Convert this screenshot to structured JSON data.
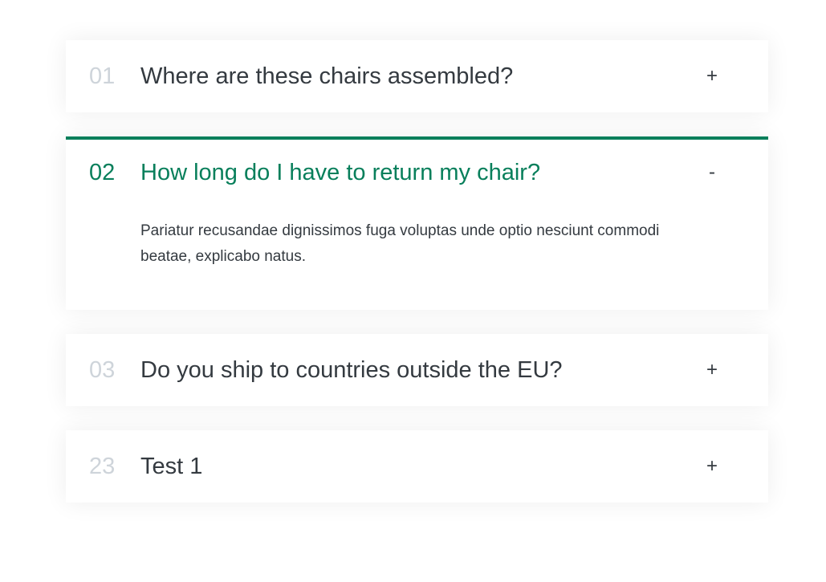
{
  "faq": {
    "items": [
      {
        "number": "01",
        "question": "Where are these chairs assembled?",
        "toggle": "+",
        "open": false,
        "answer": ""
      },
      {
        "number": "02",
        "question": "How long do I have to return my chair?",
        "toggle": "-",
        "open": true,
        "answer": "Pariatur recusandae dignissimos fuga voluptas unde optio nesciunt commodi beatae, explicabo natus."
      },
      {
        "number": "03",
        "question": "Do you ship to countries outside the EU?",
        "toggle": "+",
        "open": false,
        "answer": ""
      },
      {
        "number": "23",
        "question": "Test 1",
        "toggle": "+",
        "open": false,
        "answer": ""
      }
    ]
  },
  "colors": {
    "accent": "#087f5b",
    "number_muted": "#ced4da",
    "text": "#343a40"
  },
  "icons": {
    "expand": "plus-icon",
    "collapse": "minus-icon"
  }
}
